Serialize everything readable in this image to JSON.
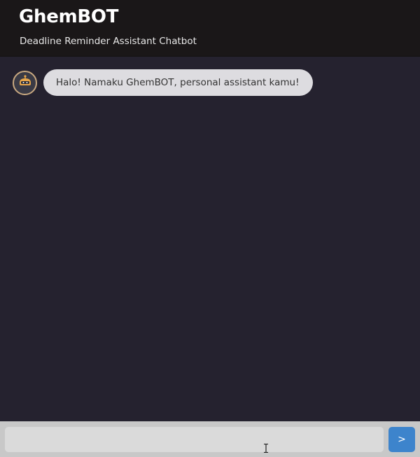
{
  "header": {
    "title": "GhemBOT",
    "subtitle": "Deadline Reminder Assistant Chatbot"
  },
  "chat": {
    "messages": [
      {
        "sender": "bot",
        "avatar_icon": "robot-icon",
        "text": "Halo! Namaku GhemBOT, personal assistant kamu!"
      }
    ]
  },
  "composer": {
    "input_value": "",
    "send_label": ">"
  },
  "colors": {
    "header_bg": "#1a1718",
    "chat_bg": "#25222f",
    "bubble_bg": "#dddce0",
    "input_bar_bg": "#c8c8c8",
    "send_button_bg": "#3d84cc",
    "avatar_accent": "#e8a64a"
  }
}
